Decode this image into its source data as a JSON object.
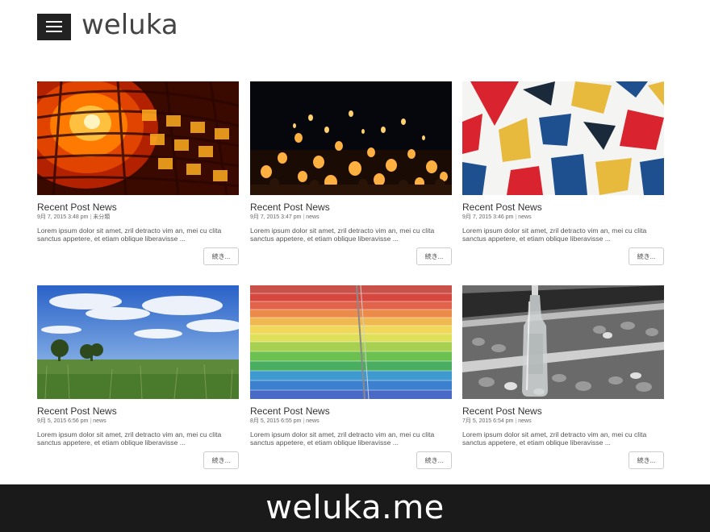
{
  "header": {
    "logo_text": "weluka",
    "menu_icon": "hamburger-menu-icon"
  },
  "cards": [
    {
      "image": "orange-light-tunnel-image",
      "title": "Recent Post News",
      "date": "9月 7, 2015 3:48 pm",
      "category": "未分類",
      "excerpt_line1": "Lorem ipsum dolor sit amet, zril detracto vim an, mei cu clita",
      "excerpt_line2": "sanctus appetere, et etiam oblique liberavisse ...",
      "more_label": "続き..."
    },
    {
      "image": "sky-lanterns-night-image",
      "title": "Recent Post News",
      "date": "9月 7, 2015 3:47 pm",
      "category": "news",
      "excerpt_line1": "Lorem ipsum dolor sit amet, zril detracto vim an, mei cu clita",
      "excerpt_line2": "sanctus appetere, et etiam oblique liberavisse ...",
      "more_label": "続き..."
    },
    {
      "image": "colorful-tiles-image",
      "title": "Recent Post News",
      "date": "9月 7, 2015 3:46 pm",
      "category": "news",
      "excerpt_line1": "Lorem ipsum dolor sit amet, zril detracto vim an, mei cu clita",
      "excerpt_line2": "sanctus appetere, et etiam oblique liberavisse ...",
      "more_label": "続き..."
    },
    {
      "image": "blue-sky-meadow-image",
      "title": "Recent Post News",
      "date": "9月 5, 2015 6:56 pm",
      "category": "news",
      "excerpt_line1": "Lorem ipsum dolor sit amet, zril detracto vim an, mei cu clita",
      "excerpt_line2": "sanctus appetere, et etiam oblique liberavisse ...",
      "more_label": "続き..."
    },
    {
      "image": "rainbow-stairs-image",
      "title": "Recent Post News",
      "date": "8月 5, 2015 6:55 pm",
      "category": "news",
      "excerpt_line1": "Lorem ipsum dolor sit amet, zril detracto vim an, mei cu clita",
      "excerpt_line2": "sanctus appetere, et etiam oblique liberavisse ...",
      "more_label": "続き..."
    },
    {
      "image": "bottle-on-railroad-image",
      "title": "Recent Post News",
      "date": "7月 5, 2015 6:54 pm",
      "category": "news",
      "excerpt_line1": "Lorem ipsum dolor sit amet, zril detracto vim an, mei cu clita",
      "excerpt_line2": "sanctus appetere, et etiam oblique liberavisse ...",
      "more_label": "続き..."
    }
  ],
  "footer": {
    "text": "weluka.me"
  },
  "colors": {
    "footer_bg": "#1a1a1a",
    "menu_bg": "#222222",
    "text": "#333333"
  }
}
